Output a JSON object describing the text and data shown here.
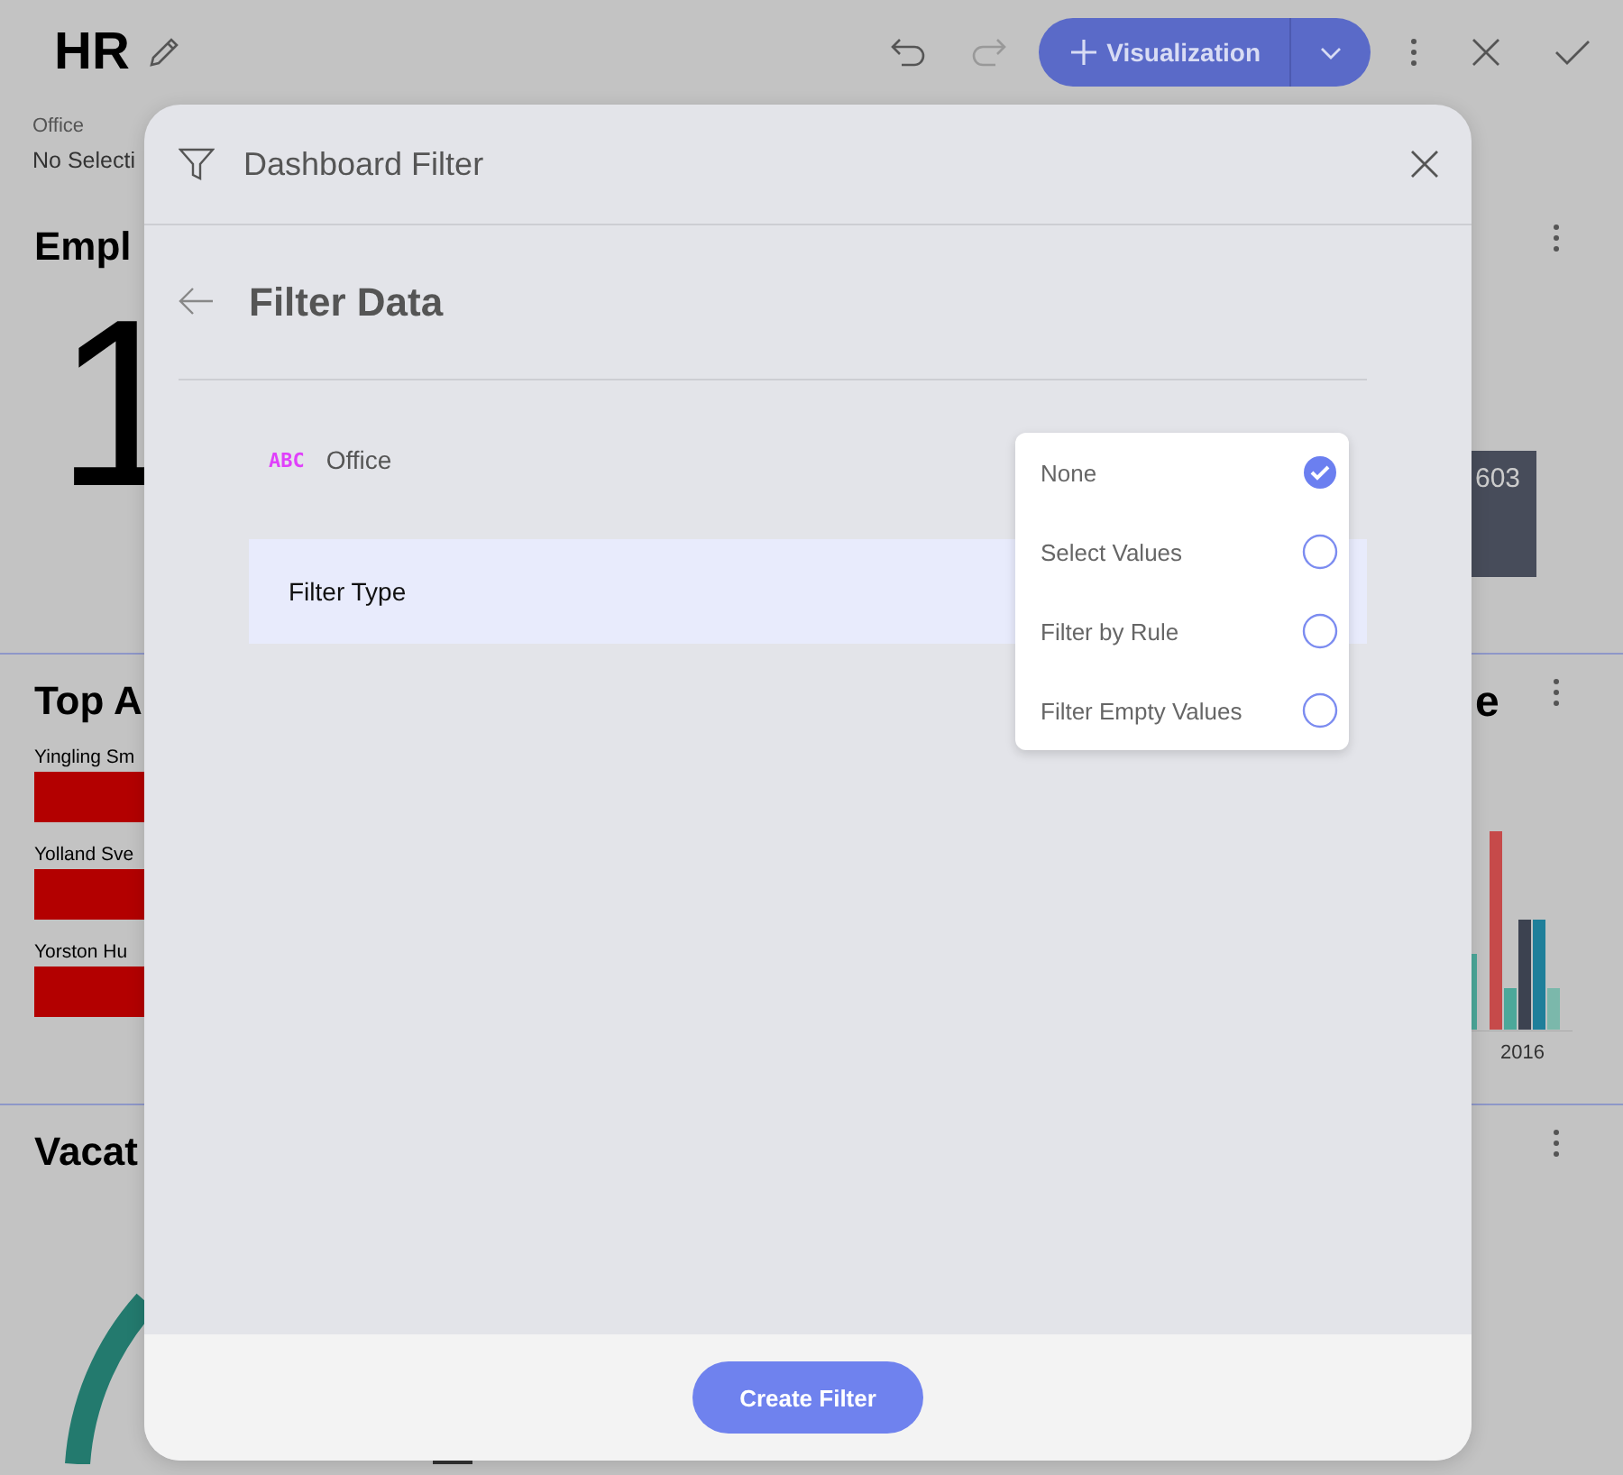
{
  "header": {
    "title": "HR",
    "add_button": "Visualization"
  },
  "filter": {
    "label": "Office",
    "value": "No Selecti"
  },
  "widgets": [
    {
      "kind": "kpi",
      "title": "Empl",
      "value": "1",
      "side": {
        "kind": "box",
        "value": "603"
      }
    },
    {
      "kind": "bars",
      "title": "Top A",
      "rows": [
        "Yingling Sm",
        "Yolland Sve",
        "Yorston Hu"
      ],
      "side": {
        "kind": "columns",
        "title": "e",
        "axis_label": "2016"
      }
    },
    {
      "kind": "gauge",
      "title": "Vacat",
      "side": {
        "kind": "empty"
      }
    }
  ],
  "dialog": {
    "title": "Dashboard Filter",
    "heading": "Filter Data",
    "field": {
      "type_badge": "ABC",
      "name": "Office"
    },
    "filter_type_label": "Filter Type",
    "options": [
      {
        "label": "None",
        "selected": true
      },
      {
        "label": "Select Values",
        "selected": false
      },
      {
        "label": "Filter by Rule",
        "selected": false
      },
      {
        "label": "Filter Empty Values",
        "selected": false
      }
    ],
    "button": "Create Filter"
  }
}
